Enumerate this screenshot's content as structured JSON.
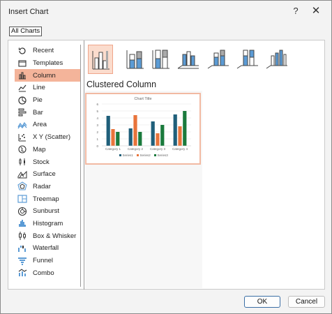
{
  "window": {
    "title": "Insert Chart",
    "help_label": "?",
    "close_label": "✕"
  },
  "tabs": {
    "all_charts": "All Charts"
  },
  "categories": [
    {
      "label": "Recent",
      "icon": "recent-icon"
    },
    {
      "label": "Templates",
      "icon": "templates-icon"
    },
    {
      "label": "Column",
      "icon": "column-chart-icon"
    },
    {
      "label": "Line",
      "icon": "line-chart-icon"
    },
    {
      "label": "Pie",
      "icon": "pie-chart-icon"
    },
    {
      "label": "Bar",
      "icon": "bar-chart-icon"
    },
    {
      "label": "Area",
      "icon": "area-chart-icon"
    },
    {
      "label": "X Y (Scatter)",
      "icon": "scatter-chart-icon"
    },
    {
      "label": "Map",
      "icon": "map-chart-icon"
    },
    {
      "label": "Stock",
      "icon": "stock-chart-icon"
    },
    {
      "label": "Surface",
      "icon": "surface-chart-icon"
    },
    {
      "label": "Radar",
      "icon": "radar-chart-icon"
    },
    {
      "label": "Treemap",
      "icon": "treemap-chart-icon"
    },
    {
      "label": "Sunburst",
      "icon": "sunburst-chart-icon"
    },
    {
      "label": "Histogram",
      "icon": "histogram-chart-icon"
    },
    {
      "label": "Box & Whisker",
      "icon": "box-whisker-chart-icon"
    },
    {
      "label": "Waterfall",
      "icon": "waterfall-chart-icon"
    },
    {
      "label": "Funnel",
      "icon": "funnel-chart-icon"
    },
    {
      "label": "Combo",
      "icon": "combo-chart-icon"
    }
  ],
  "selected_category": "Column",
  "subtypes": [
    {
      "name": "clustered-column",
      "icon": "clustered-column-icon"
    },
    {
      "name": "stacked-column",
      "icon": "stacked-column-icon"
    },
    {
      "name": "100-stacked-column",
      "icon": "100-stacked-column-icon"
    },
    {
      "name": "3d-clustered-column",
      "icon": "3d-clustered-column-icon"
    },
    {
      "name": "3d-stacked-column",
      "icon": "3d-stacked-column-icon"
    },
    {
      "name": "3d-100-stacked-column",
      "icon": "3d-100-stacked-column-icon"
    },
    {
      "name": "3d-column",
      "icon": "3d-column-icon"
    }
  ],
  "selected_subtype_title": "Clustered Column",
  "buttons": {
    "ok": "OK",
    "cancel": "Cancel"
  },
  "colors": {
    "accent": "#f4b49a",
    "series1": "#1f5f7a",
    "series2": "#e8743b",
    "series3": "#1a7a3c",
    "icon_blue": "#5b9bd5"
  },
  "chart_data": {
    "type": "bar",
    "title": "Chart Title",
    "categories": [
      "Category 1",
      "Category 2",
      "Category 3",
      "Category 4"
    ],
    "series": [
      {
        "name": "Series1",
        "values": [
          4.3,
          2.5,
          3.5,
          4.5
        ]
      },
      {
        "name": "Series2",
        "values": [
          2.4,
          4.4,
          1.8,
          2.8
        ]
      },
      {
        "name": "Series3",
        "values": [
          2,
          2,
          3,
          5
        ]
      }
    ],
    "ylim": [
      0,
      6
    ],
    "yticks": [
      "0",
      "1",
      "2",
      "3",
      "4",
      "5",
      "6"
    ],
    "grid": true,
    "legend": "bottom"
  }
}
